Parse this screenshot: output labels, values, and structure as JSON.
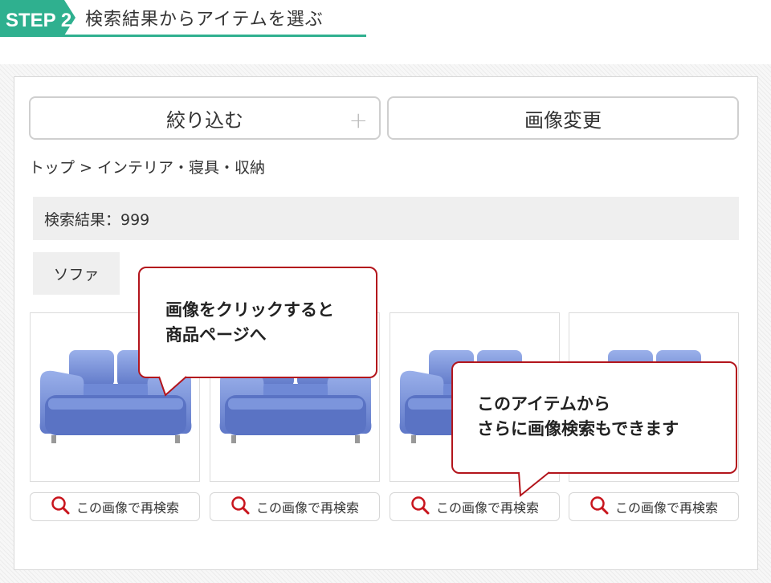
{
  "step": {
    "badge": "STEP 2",
    "title": "検索結果からアイテムを選ぶ",
    "accent": "#2fb08f"
  },
  "toolbar": {
    "narrow_label": "絞り込む",
    "narrow_plus": "+",
    "change_label": "画像変更"
  },
  "breadcrumb": "トップ > インテリア・寝具・収納",
  "results": {
    "label": "検索結果：999"
  },
  "tag": {
    "label": "ソファ"
  },
  "items": [
    {
      "image": "blue-sofa",
      "research_label": "この画像で再検索"
    },
    {
      "image": "blue-sofa",
      "research_label": "この画像で再検索"
    },
    {
      "image": "blue-sofa",
      "research_label": "この画像で再検索"
    },
    {
      "image": "blue-sofa",
      "research_label": "この画像で再検索"
    }
  ],
  "callouts": {
    "image_click": {
      "line1": "画像をクリックすると",
      "line2": "商品ページへ"
    },
    "research": {
      "line1": "このアイテムから",
      "line2": "さらに画像検索もできます"
    },
    "border_color": "#b3151c"
  }
}
